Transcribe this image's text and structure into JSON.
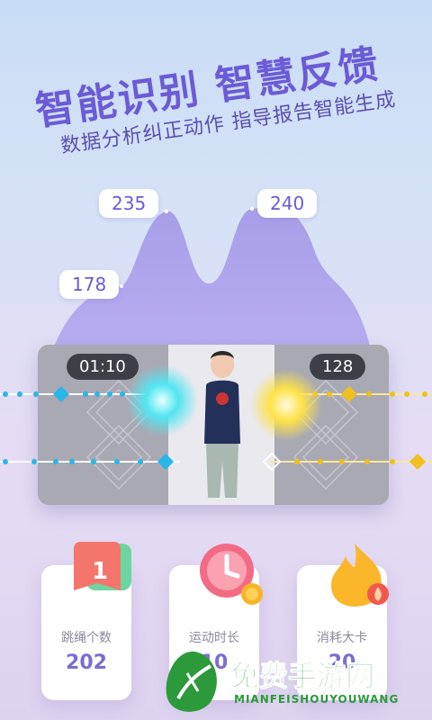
{
  "headline": {
    "title": "智能识别 智慧反馈",
    "subtitle": "数据分析纠正动作 指导报告智能生成"
  },
  "chart": {
    "labels": [
      "178",
      "235",
      "240"
    ]
  },
  "video": {
    "time": "01:10",
    "count": "128"
  },
  "cards": [
    {
      "label": "跳绳个数",
      "value": "202",
      "icon": "calendar-icon",
      "icon_text": "1"
    },
    {
      "label": "运动时长",
      "value": "10",
      "icon": "clock-icon"
    },
    {
      "label": "消耗大卡",
      "value": "20",
      "icon": "flame-icon"
    }
  ],
  "watermark": {
    "title": "免费手游网",
    "subtitle": "MIANFEISHOUYOUWANG"
  },
  "colors": {
    "accent": "#6b5bd6",
    "chart_fill": "#a89ee8",
    "panel": "#a9a9b3",
    "card_value": "#7a6ecf"
  }
}
